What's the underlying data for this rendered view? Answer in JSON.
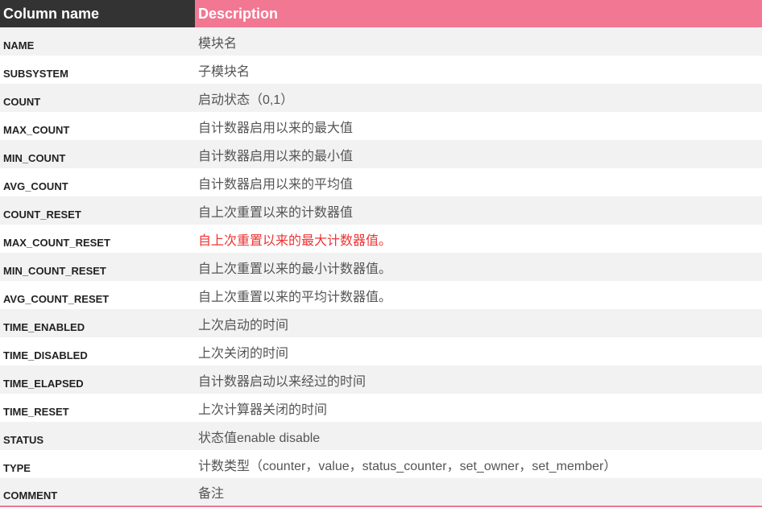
{
  "headers": {
    "col1": "Column name",
    "col2": "Description"
  },
  "rows": [
    {
      "name": "NAME",
      "desc": "模块名",
      "highlight": false
    },
    {
      "name": "SUBSYSTEM",
      "desc": "子模块名",
      "highlight": false
    },
    {
      "name": "COUNT",
      "desc": "启动状态（0,1）",
      "highlight": false
    },
    {
      "name": "MAX_COUNT",
      "desc": "自计数器启用以来的最大值",
      "highlight": false
    },
    {
      "name": "MIN_COUNT",
      "desc": "自计数器启用以来的最小值",
      "highlight": false
    },
    {
      "name": "AVG_COUNT",
      "desc": "自计数器启用以来的平均值",
      "highlight": false
    },
    {
      "name": "COUNT_RESET",
      "desc": "自上次重置以来的计数器值",
      "highlight": false
    },
    {
      "name": "MAX_COUNT_RESET",
      "desc": "自上次重置以来的最大计数器值。",
      "highlight": true
    },
    {
      "name": "MIN_COUNT_RESET",
      "desc": "自上次重置以来的最小计数器值。",
      "highlight": false
    },
    {
      "name": "AVG_COUNT_RESET",
      "desc": "自上次重置以来的平均计数器值。",
      "highlight": false
    },
    {
      "name": "TIME_ENABLED",
      "desc": "上次启动的时间",
      "highlight": false
    },
    {
      "name": "TIME_DISABLED",
      "desc": "上次关闭的时间",
      "highlight": false
    },
    {
      "name": "TIME_ELAPSED",
      "desc": "自计数器启动以来经过的时间",
      "highlight": false
    },
    {
      "name": "TIME_RESET",
      "desc": "上次计算器关闭的时间",
      "highlight": false
    },
    {
      "name": "STATUS",
      "desc": "状态值enable disable",
      "highlight": false
    },
    {
      "name": "TYPE",
      "desc": "计数类型（counter，value，status_counter，set_owner，set_member）",
      "highlight": false
    },
    {
      "name": "COMMENT",
      "desc": "备注",
      "highlight": false
    }
  ]
}
